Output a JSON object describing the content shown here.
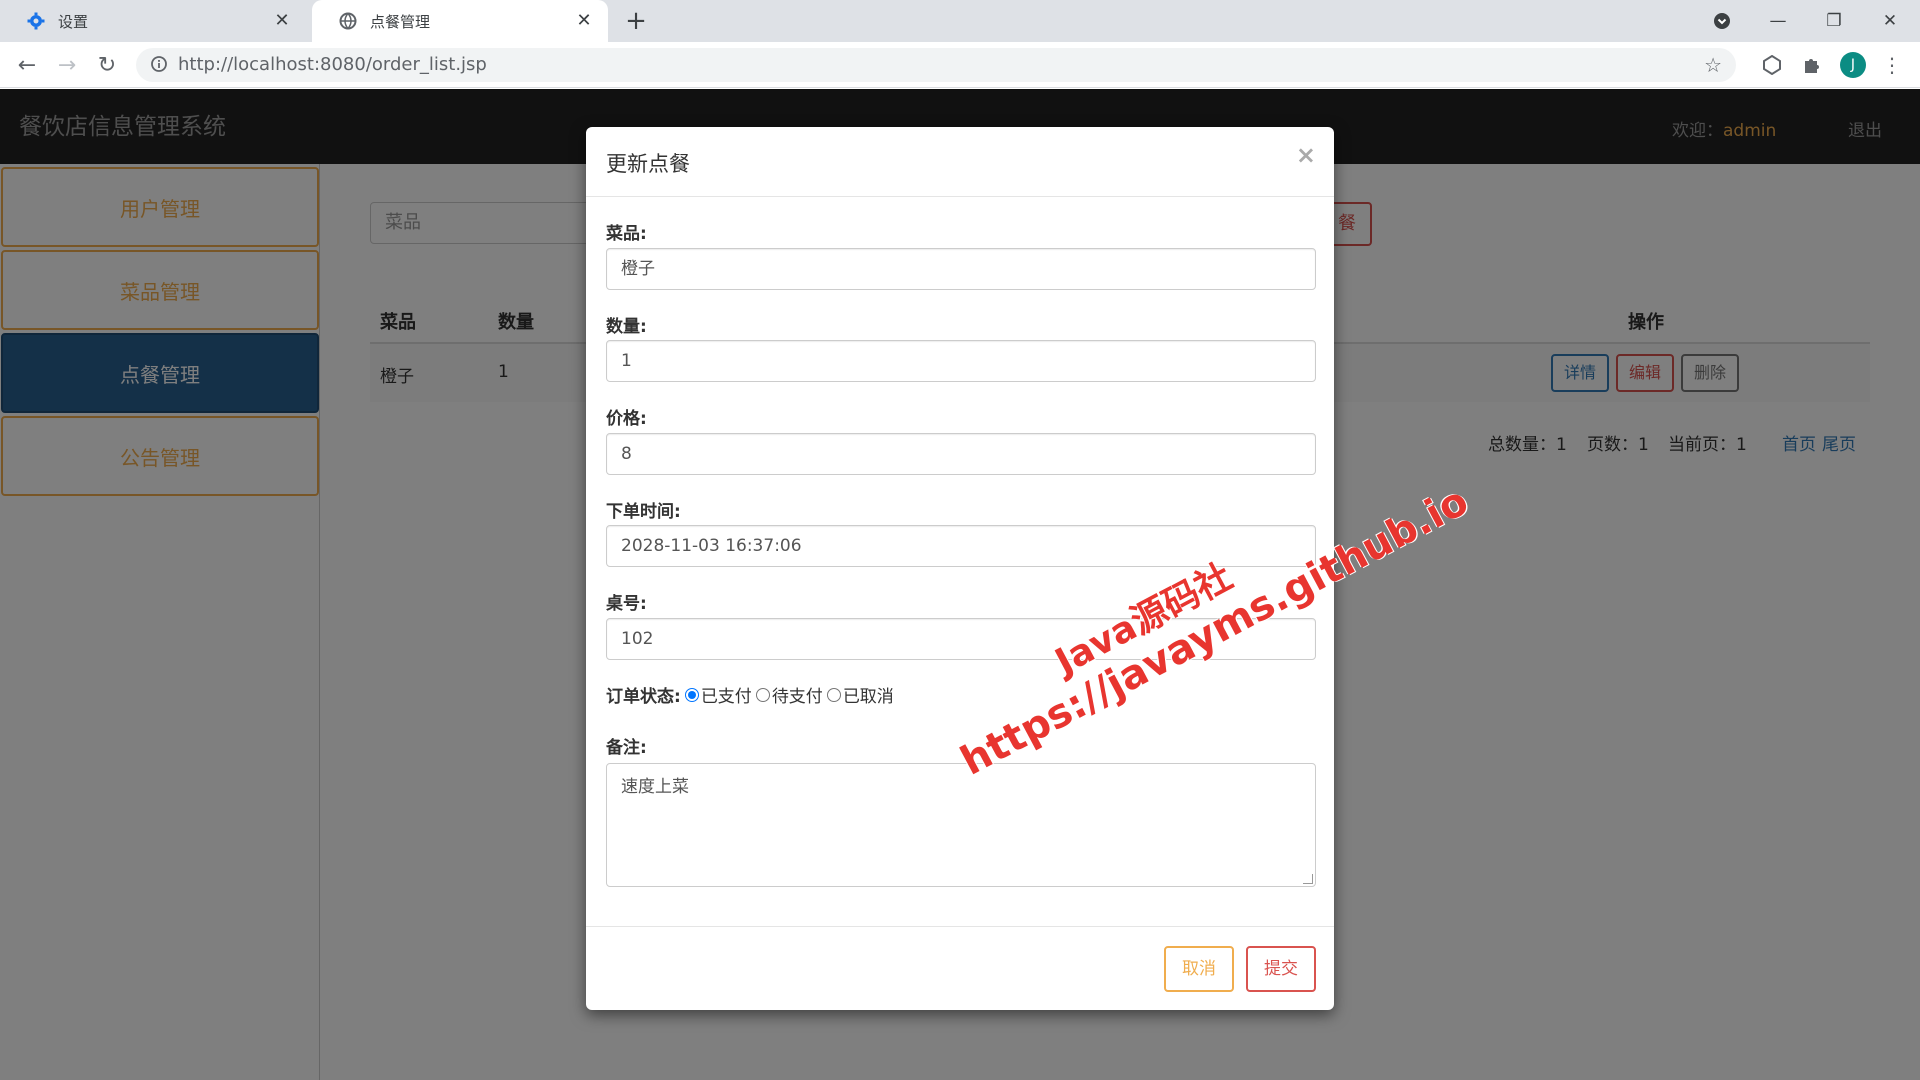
{
  "browser": {
    "tabs": [
      {
        "label": "设置",
        "icon": "gear-icon",
        "active": false
      },
      {
        "label": "点餐管理",
        "icon": "globe-icon",
        "active": true
      }
    ],
    "address": {
      "host": "http://localhost",
      "rest": ":8080/order_list.jsp"
    },
    "profile_initial": "J"
  },
  "app": {
    "title": "餐饮店信息管理系统",
    "welcome_prefix": "欢迎：",
    "user": "admin",
    "logout": "退出",
    "sidebar": [
      {
        "label": "用户管理"
      },
      {
        "label": "菜品管理"
      },
      {
        "label": "点餐管理"
      },
      {
        "label": "公告管理"
      }
    ],
    "search_placeholder": "菜品",
    "add_button_label": "餐",
    "table": {
      "headers": {
        "dish": "菜品",
        "qty": "数量",
        "ops": "操作"
      },
      "rows": [
        {
          "dish": "橙子",
          "qty": "1"
        }
      ],
      "ops": {
        "detail": "详情",
        "edit": "编辑",
        "delete": "删除"
      }
    },
    "pager": {
      "total": "总数量：1",
      "pages": "页数：1",
      "current": "当前页：1",
      "first": "首页",
      "last": "尾页"
    }
  },
  "modal": {
    "title": "更新点餐",
    "close": "×",
    "fields": {
      "dish_label": "菜品:",
      "dish_value": "橙子",
      "qty_label": "数量:",
      "qty_value": "1",
      "price_label": "价格:",
      "price_value": "8",
      "time_label": "下单时间:",
      "time_value": "2028-11-03 16:37:06",
      "table_label": "桌号:",
      "table_value": "102",
      "status_label": "订单状态:",
      "status_options": [
        "已支付",
        "待支付",
        "已取消"
      ],
      "status_selected": "已支付",
      "note_label": "备注:",
      "note_value": "速度上菜"
    },
    "cancel": "取消",
    "submit": "提交"
  },
  "watermark": {
    "line1": "Java源码社",
    "line2": "https://javayms.github.io"
  },
  "colors": {
    "warning": "#f0ad4e",
    "danger": "#d9534f",
    "primary": "#337ab7",
    "active_nav": "#286090",
    "header_bg": "#222222"
  }
}
